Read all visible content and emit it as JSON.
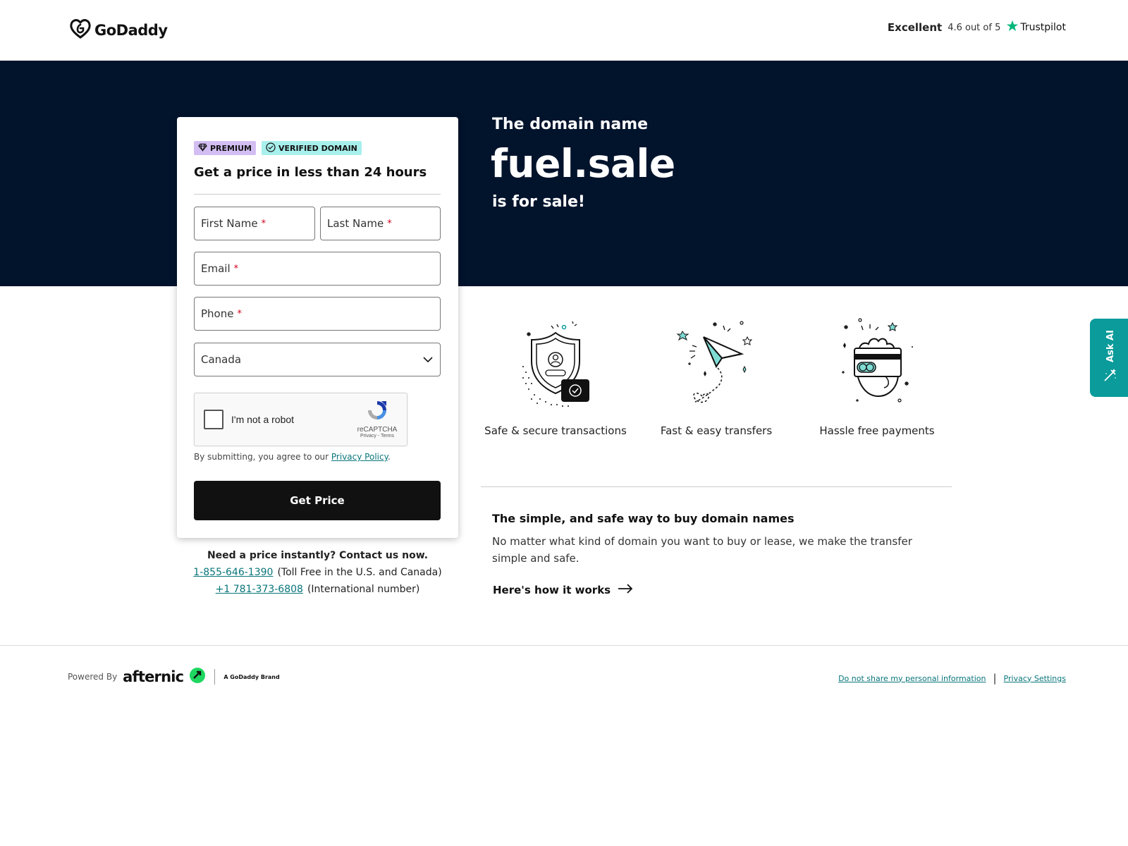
{
  "header": {
    "brand": "GoDaddy",
    "rating_label": "Excellent",
    "rating_score": "4.6 out of 5",
    "rating_source": "Trustpilot"
  },
  "hero": {
    "pre_text": "The domain name",
    "domain": "fuel.sale",
    "post_text": "is for sale!"
  },
  "form": {
    "badge_premium": "PREMIUM",
    "badge_verified": "VERIFIED DOMAIN",
    "title": "Get a price in less than 24 hours",
    "first_name_label": "First Name",
    "last_name_label": "Last Name",
    "email_label": "Email",
    "phone_label": "Phone",
    "required_mark": "*",
    "country_value": "Canada",
    "captcha_label": "I'm not a robot",
    "captcha_brand": "reCAPTCHA",
    "captcha_links": "Privacy - Terms",
    "agree_text": "By submitting, you agree to our",
    "privacy_link": "Privacy Policy",
    "agree_end": ".",
    "submit_label": "Get Price"
  },
  "contact": {
    "question": "Need a price instantly? Contact us now.",
    "phone_tollfree": "1-855-646-1390",
    "phone_tollfree_note": "(Toll Free in the U.S. and Canada)",
    "phone_intl": "+1 781-373-6808",
    "phone_intl_note": "(International number)"
  },
  "features": [
    {
      "label": "Safe & secure transactions",
      "icon": "shield-icon"
    },
    {
      "label": "Fast & easy transfers",
      "icon": "paper-plane-icon"
    },
    {
      "label": "Hassle free payments",
      "icon": "credit-card-icon"
    }
  ],
  "info": {
    "title": "The simple, and safe way to buy domain names",
    "body": "No matter what kind of domain you want to buy or lease, we make the transfer simple and safe.",
    "link": "Here's how it works"
  },
  "ask_ai": {
    "label": "Ask AI"
  },
  "footer": {
    "powered_by": "Powered By",
    "afternic": "afternic",
    "godaddy_brand": "A GoDaddy Brand",
    "link_do_not_share": "Do not share my personal information",
    "link_privacy_settings": "Privacy Settings"
  },
  "colors": {
    "hero_bg": "#02132c",
    "accent_teal": "#0a9b9a",
    "link_teal": "#09757a",
    "button_black": "#111111",
    "premium_badge": "#d3bef3",
    "verified_badge": "#a8f0ec",
    "required_red": "#d0021b",
    "trustpilot_green": "#00b67a"
  }
}
